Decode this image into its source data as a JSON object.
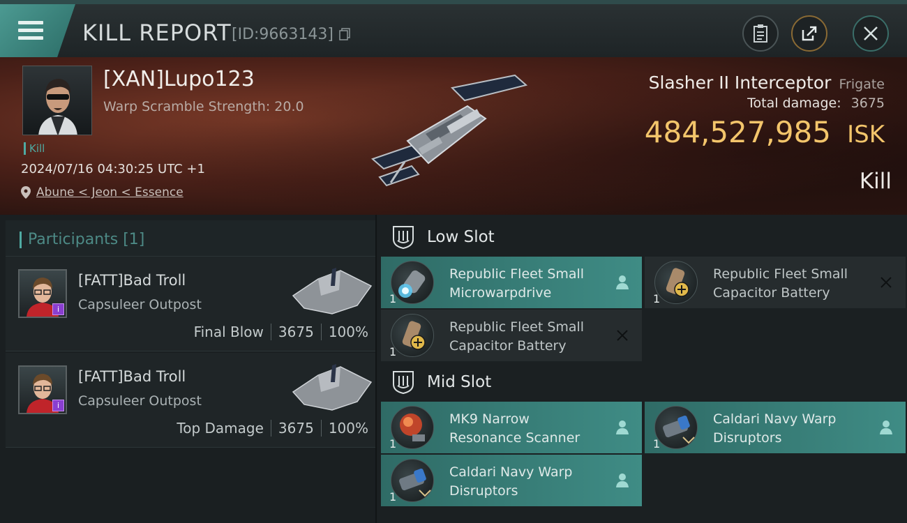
{
  "header": {
    "title": "KILL REPORT",
    "report_id": "[ID:9663143]",
    "icons": [
      "menu-icon",
      "copy-icon",
      "clipboard-icon",
      "share-icon",
      "close-icon"
    ]
  },
  "victim": {
    "name": "[XAN]Lupo123",
    "warp_strength": "Warp Scramble Strength: 20.0",
    "tag": "Kill",
    "datetime": "2024/07/16 04:30:25 UTC +1",
    "location": "Abune < Jeon < Essence",
    "ship_name": "Slasher II Interceptor",
    "ship_class": "Frigate",
    "damage_label": "Total damage:",
    "damage_value": "3675",
    "isk_value": "484,527,985",
    "isk_unit": "ISK",
    "result": "Kill"
  },
  "participants": {
    "label": "Participants [1]",
    "items": [
      {
        "name": "[FATT]Bad Troll",
        "corp": "Capsuleer Outpost",
        "role": "Final Blow",
        "damage": "3675",
        "percent": "100%"
      },
      {
        "name": "[FATT]Bad Troll",
        "corp": "Capsuleer Outpost",
        "role": "Top Damage",
        "damage": "3675",
        "percent": "100%"
      }
    ]
  },
  "slots": {
    "low": {
      "label": "Low Slot",
      "modules": [
        {
          "name_line1": "Republic Fleet Small",
          "name_line2": "Microwarpdrive",
          "qty": "1",
          "status": "fitted"
        },
        {
          "name_line1": "Republic Fleet Small",
          "name_line2": "Capacitor Battery",
          "qty": "1",
          "status": "dropped"
        },
        {
          "name_line1": "Republic Fleet Small",
          "name_line2": "Capacitor Battery",
          "qty": "1",
          "status": "dropped"
        }
      ]
    },
    "mid": {
      "label": "Mid Slot",
      "modules": [
        {
          "name_line1": "MK9 Narrow",
          "name_line2": "Resonance Scanner",
          "qty": "1",
          "status": "fitted"
        },
        {
          "name_line1": "Caldari Navy Warp",
          "name_line2": "Disruptors",
          "qty": "1",
          "status": "fitted"
        },
        {
          "name_line1": "Caldari Navy Warp",
          "name_line2": "Disruptors",
          "qty": "1",
          "status": "fitted"
        }
      ]
    }
  },
  "colors": {
    "accent": "#4faaa2",
    "isk": "#f3c56b",
    "fitted": "#3f8c85",
    "badge": "#8a3fd0"
  }
}
